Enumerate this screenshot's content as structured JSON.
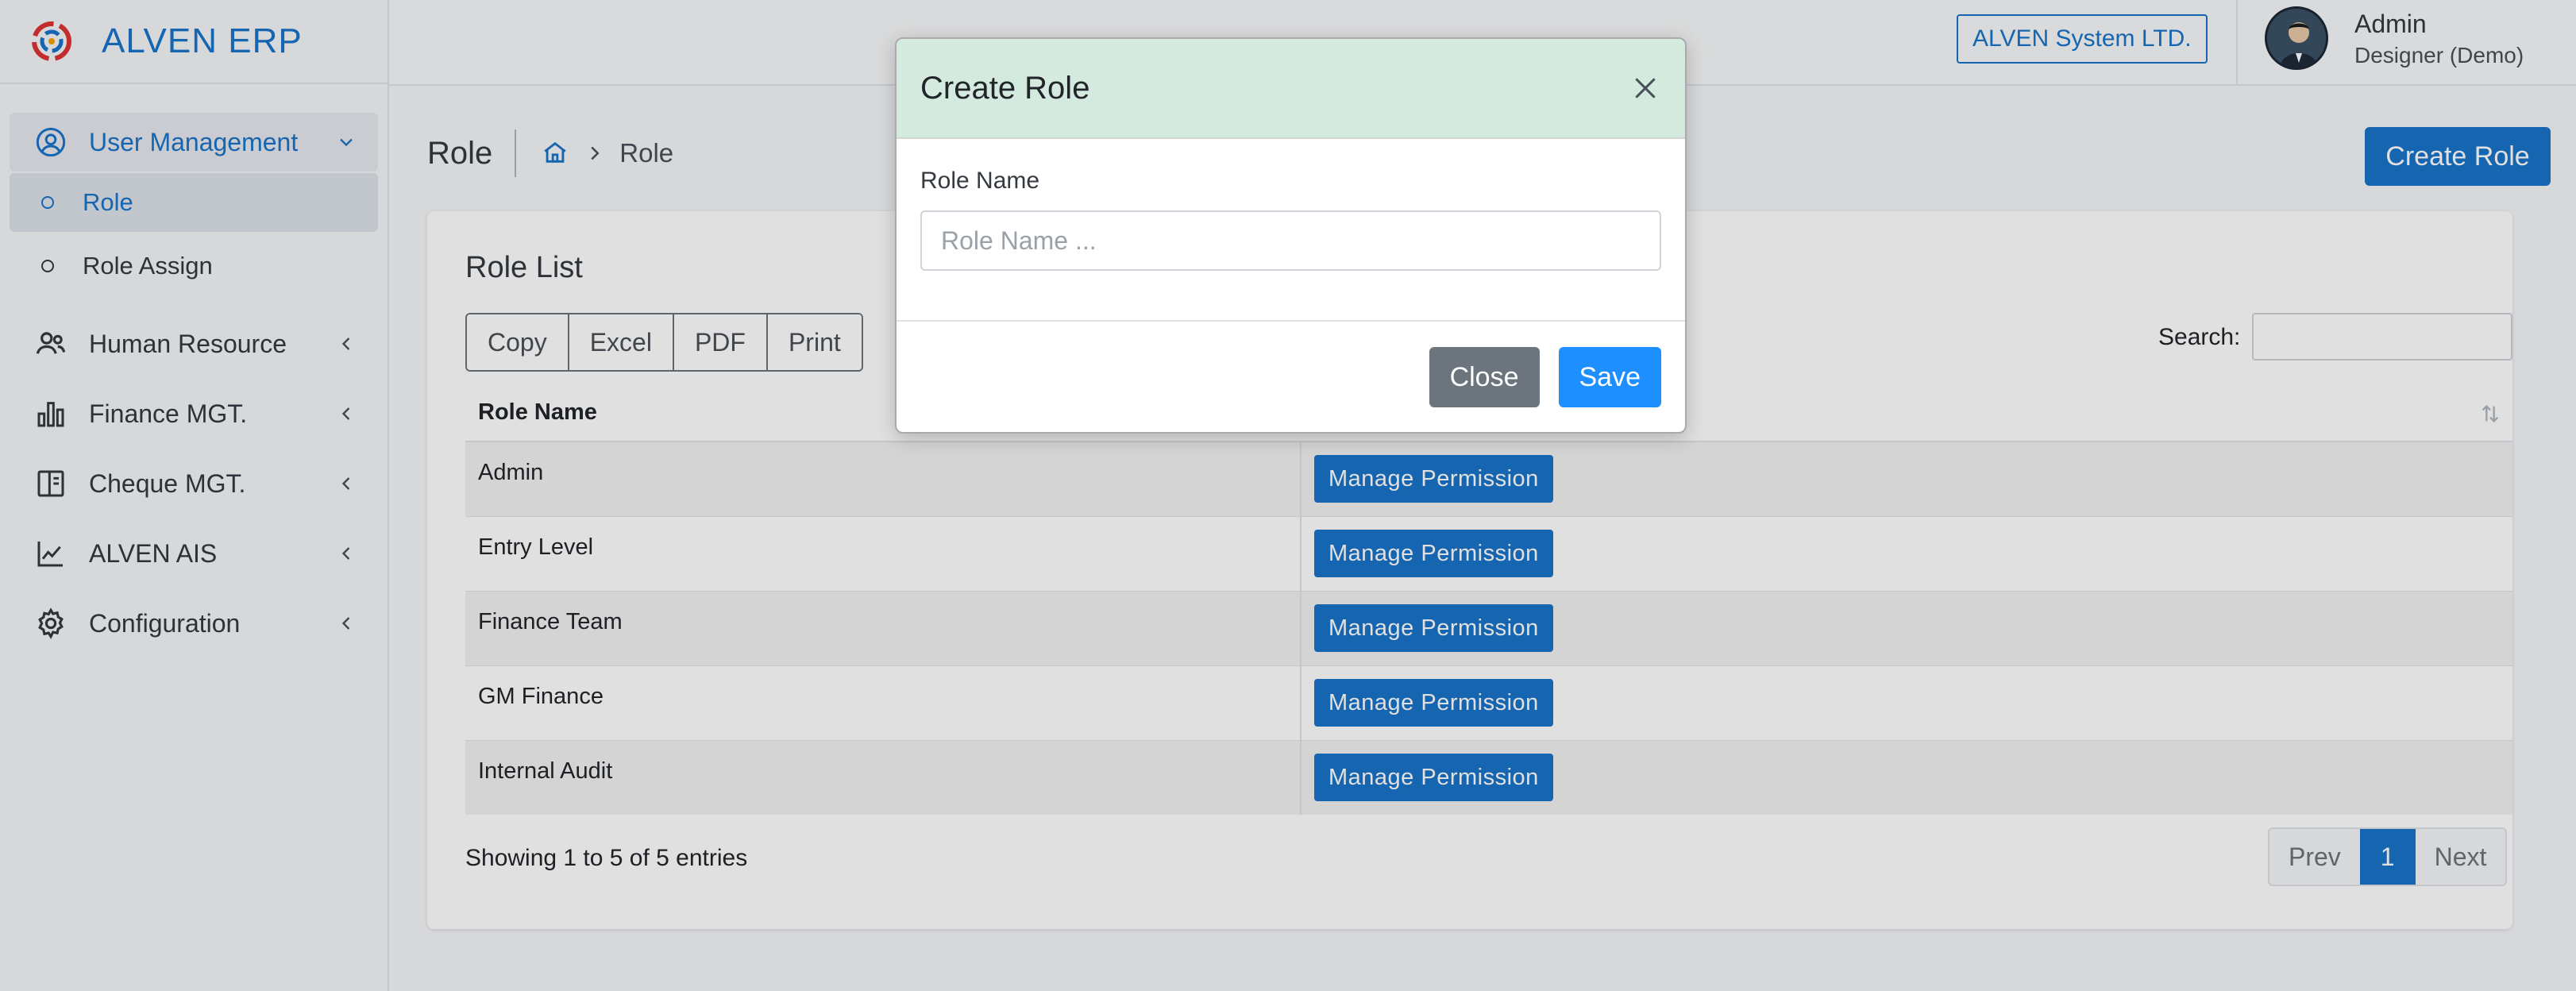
{
  "app": {
    "brand": "ALVEN ERP"
  },
  "topbar": {
    "company": "ALVEN System LTD.",
    "user_name": "Admin",
    "user_role": "Designer (Demo)"
  },
  "sidebar": {
    "items": [
      {
        "label": "User Management",
        "icon": "user-circle-icon",
        "expanded": true
      },
      {
        "label": "Role"
      },
      {
        "label": "Role Assign"
      },
      {
        "label": "Human Resource",
        "icon": "users-icon"
      },
      {
        "label": "Finance MGT.",
        "icon": "bar-chart-icon"
      },
      {
        "label": "Cheque MGT.",
        "icon": "book-icon"
      },
      {
        "label": "ALVEN AIS",
        "icon": "line-chart-icon"
      },
      {
        "label": "Configuration",
        "icon": "gear-icon"
      }
    ]
  },
  "page": {
    "title": "Role",
    "breadcrumb_current": "Role",
    "create_button": "Create Role"
  },
  "card": {
    "title": "Role List",
    "export_buttons": [
      "Copy",
      "Excel",
      "PDF",
      "Print"
    ],
    "search_label": "Search:",
    "table": {
      "headers": [
        "Role Name",
        ""
      ],
      "rows": [
        {
          "name": "Admin",
          "action": "Manage Permission"
        },
        {
          "name": "Entry Level",
          "action": "Manage Permission"
        },
        {
          "name": "Finance Team",
          "action": "Manage Permission"
        },
        {
          "name": "GM Finance",
          "action": "Manage Permission"
        },
        {
          "name": "Internal Audit",
          "action": "Manage Permission"
        }
      ]
    },
    "info": "Showing 1 to 5 of 5 entries",
    "pagination": {
      "prev": "Prev",
      "current": "1",
      "next": "Next"
    }
  },
  "modal": {
    "title": "Create Role",
    "field_label": "Role Name",
    "field_placeholder": "Role Name ...",
    "field_value": "",
    "close_label": "Close",
    "save_label": "Save"
  },
  "colors": {
    "primary": "#1a73c9",
    "save": "#1e8fff",
    "modal_header": "#d4eadf",
    "secondary": "#6c757d"
  }
}
